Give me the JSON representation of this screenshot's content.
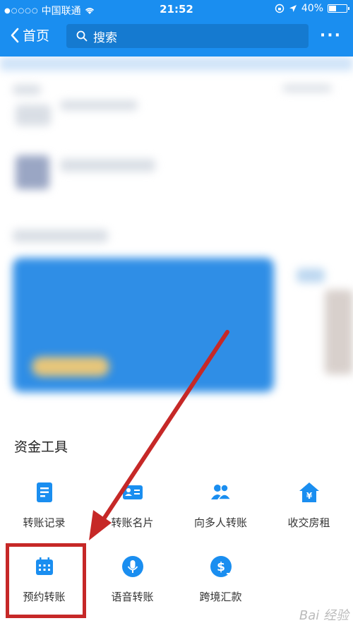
{
  "status": {
    "carrier": "中国联通",
    "time": "21:52",
    "battery": "40%",
    "battery_level": 0.4
  },
  "nav": {
    "back_label": "首页",
    "search_placeholder": "搜索"
  },
  "section": {
    "title": "资金工具"
  },
  "tools": [
    {
      "label": "转账记录",
      "icon": "document-icon"
    },
    {
      "label": "转账名片",
      "icon": "card-icon"
    },
    {
      "label": "向多人转账",
      "icon": "people-icon"
    },
    {
      "label": "收交房租",
      "icon": "house-yen-icon"
    },
    {
      "label": "预约转账",
      "icon": "calendar-icon"
    },
    {
      "label": "语音转账",
      "icon": "microphone-icon"
    },
    {
      "label": "跨境汇款",
      "icon": "dollar-icon"
    }
  ],
  "colors": {
    "primary": "#1a8ef0",
    "highlight": "#c62827"
  }
}
